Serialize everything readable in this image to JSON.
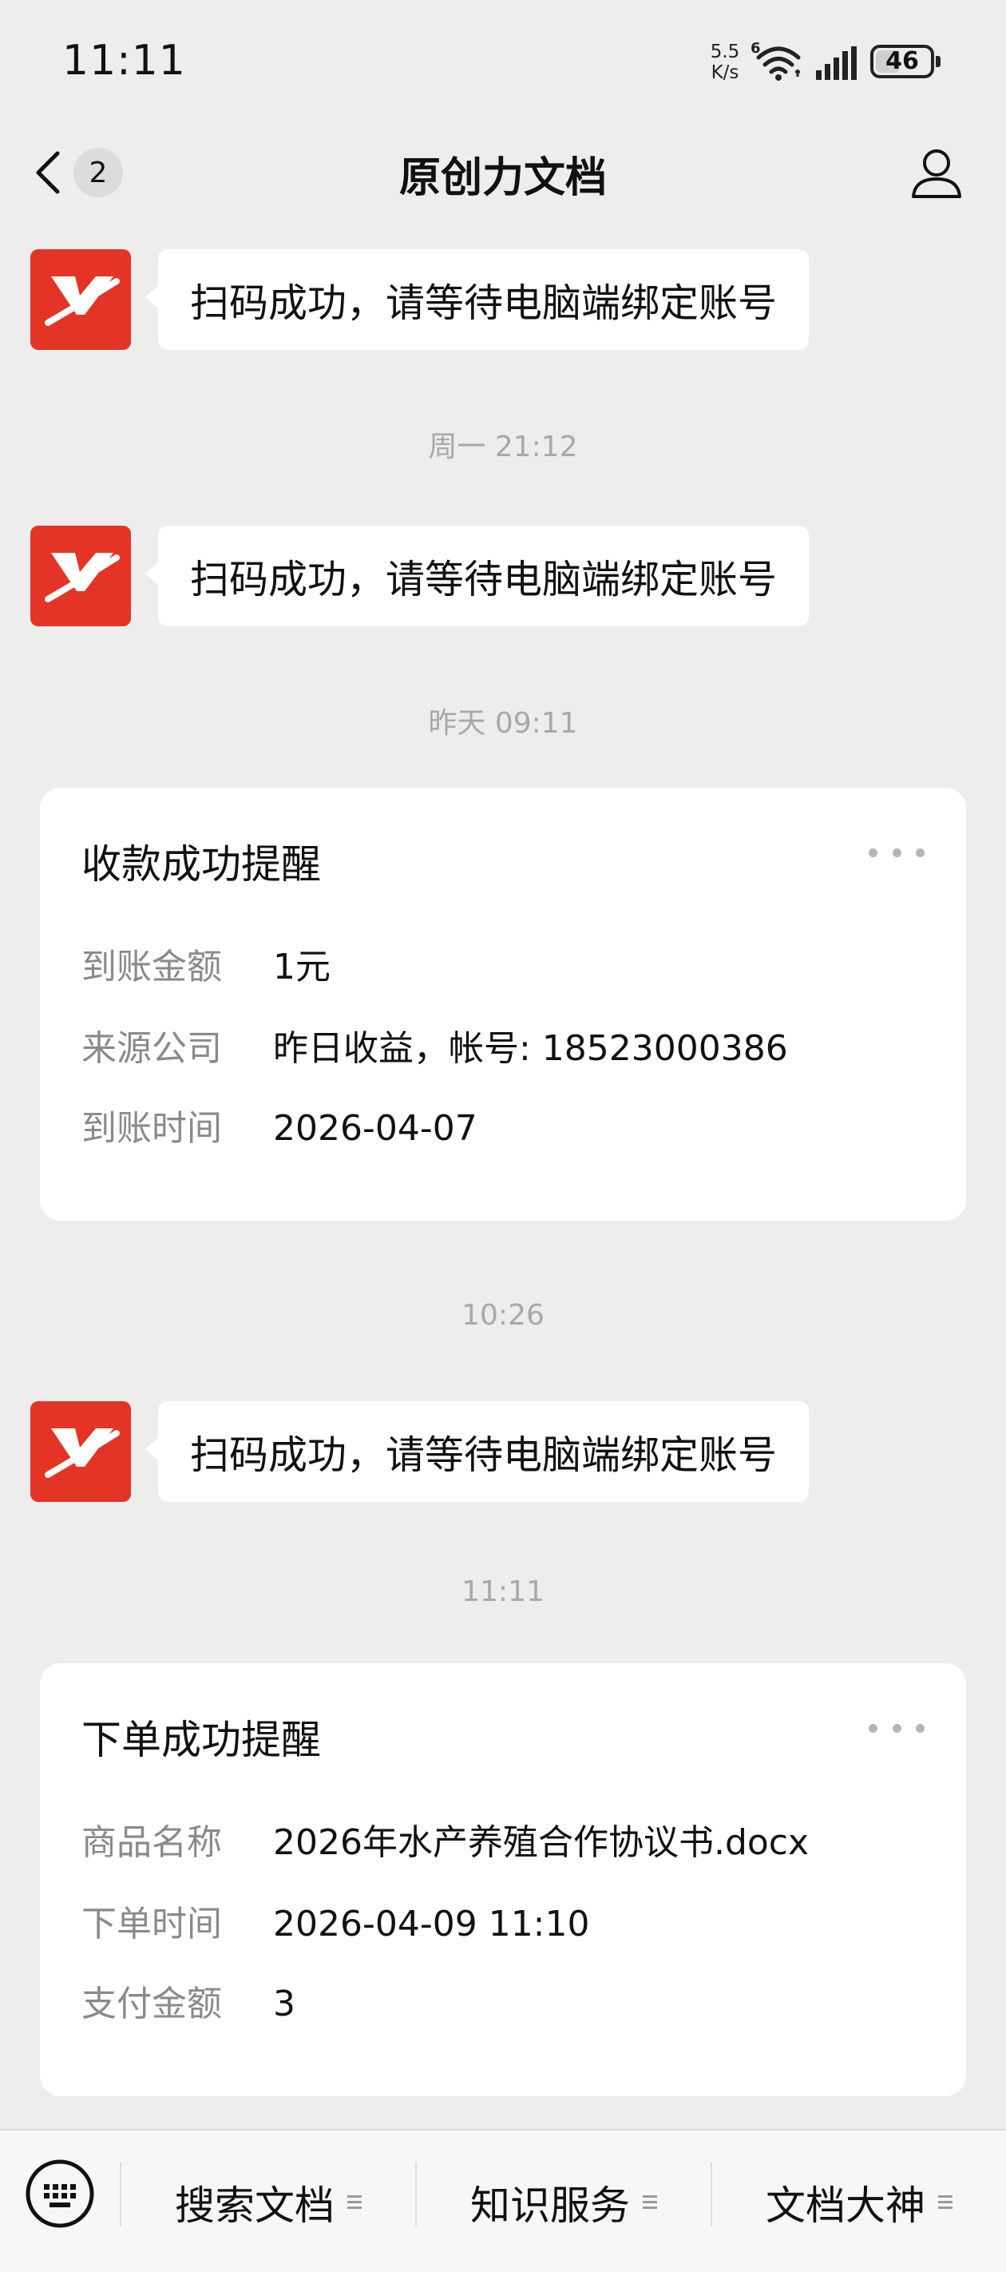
{
  "status_bar": {
    "time": "11:11",
    "net_speed_value": "5.5",
    "net_speed_unit": "K/s",
    "network_type": "6",
    "battery_level": "46",
    "battery_fraction": 0.46,
    "icons": [
      "wifi-icon",
      "signal-icon",
      "battery-icon"
    ]
  },
  "header": {
    "title": "原创力文档",
    "unread_count": "2",
    "icons": [
      "back-chevron-icon",
      "profile-icon"
    ]
  },
  "colors": {
    "brand_red": "#e43425",
    "background": "#ededed",
    "bubble": "#ffffff",
    "muted_text": "#a8a8a8",
    "label_text": "#8a8a8a"
  },
  "messages": {
    "msg1": {
      "text": "扫码成功，请等待电脑端绑定账号"
    },
    "ts1": "周一 21:12",
    "msg2": {
      "text": "扫码成功，请等待电脑端绑定账号"
    },
    "ts2": "昨天 09:11",
    "card1": {
      "title": "收款成功提醒",
      "rows": [
        {
          "label": "到账金额",
          "value": "1元"
        },
        {
          "label": "来源公司",
          "value": "昨日收益，帐号: 18523000386"
        },
        {
          "label": "到账时间",
          "value": "2026-04-07"
        }
      ]
    },
    "ts3": "10:26",
    "msg3": {
      "text": "扫码成功，请等待电脑端绑定账号"
    },
    "ts4": "11:11",
    "card2": {
      "title": "下单成功提醒",
      "rows": [
        {
          "label": "商品名称",
          "value": "2026年水产养殖合作协议书.docx"
        },
        {
          "label": "下单时间",
          "value": "2026-04-09 11:10"
        },
        {
          "label": "支付金额",
          "value": "3"
        }
      ]
    }
  },
  "bottom_menu": {
    "items": [
      {
        "label": "搜索文档"
      },
      {
        "label": "知识服务"
      },
      {
        "label": "文档大神"
      }
    ],
    "icons": [
      "keyboard-icon",
      "menu-lines-icon"
    ]
  }
}
